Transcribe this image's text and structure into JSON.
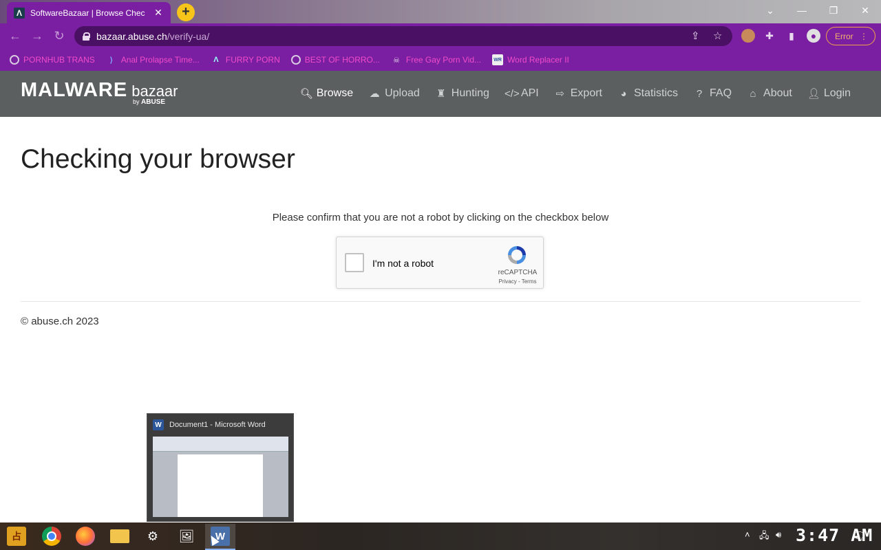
{
  "browser": {
    "tab": {
      "title": "SoftwareBazaar | Browse Chec",
      "favicon": "Λ"
    },
    "new_tab_label": "+",
    "window_controls": {
      "minimize": "—",
      "restore": "❐",
      "close": "✕",
      "dropdown": "⌄"
    },
    "url": {
      "host": "bazaar.abuse.ch",
      "path": "/verify-ua/"
    },
    "error_label": "Error",
    "bookmarks": [
      {
        "label": "PORNHUB TRANS",
        "icon": "globe-icon"
      },
      {
        "label": "Anal Prolapse Time...",
        "icon": "bracket-icon"
      },
      {
        "label": "FURRY PORN",
        "icon": "lambda-icon"
      },
      {
        "label": "BEST OF HORRO...",
        "icon": "globe-icon"
      },
      {
        "label": "Free Gay Porn Vid...",
        "icon": "skull-icon"
      },
      {
        "label": "Word Replacer II",
        "icon": "wr-icon"
      }
    ]
  },
  "site": {
    "logo_main": "MALWARE",
    "logo_sub": "bazaar",
    "logo_by": "by",
    "logo_brand": "ABUSE",
    "nav": [
      {
        "label": "Browse",
        "icon": "search-icon",
        "active": true
      },
      {
        "label": "Upload",
        "icon": "cloud-upload-icon"
      },
      {
        "label": "Hunting",
        "icon": "castle-icon"
      },
      {
        "label": "API",
        "icon": "code-icon"
      },
      {
        "label": "Export",
        "icon": "export-icon"
      },
      {
        "label": "Statistics",
        "icon": "pie-chart-icon"
      },
      {
        "label": "FAQ",
        "icon": "question-icon"
      },
      {
        "label": "About",
        "icon": "institution-icon"
      },
      {
        "label": "Login",
        "icon": "user-icon"
      }
    ]
  },
  "main": {
    "title": "Checking your browser",
    "instruction": "Please confirm that you are not a robot by clicking on the checkbox below",
    "recaptcha": {
      "label": "I'm not a robot",
      "brand": "reCAPTCHA",
      "links": "Privacy - Terms"
    },
    "copyright": "© abuse.ch 2023"
  },
  "preview": {
    "title": "Document1 - Microsoft Word",
    "app_icon": "W"
  },
  "taskbar": {
    "clock": "3:47 AM",
    "start_label": "占",
    "word_label": "W"
  }
}
